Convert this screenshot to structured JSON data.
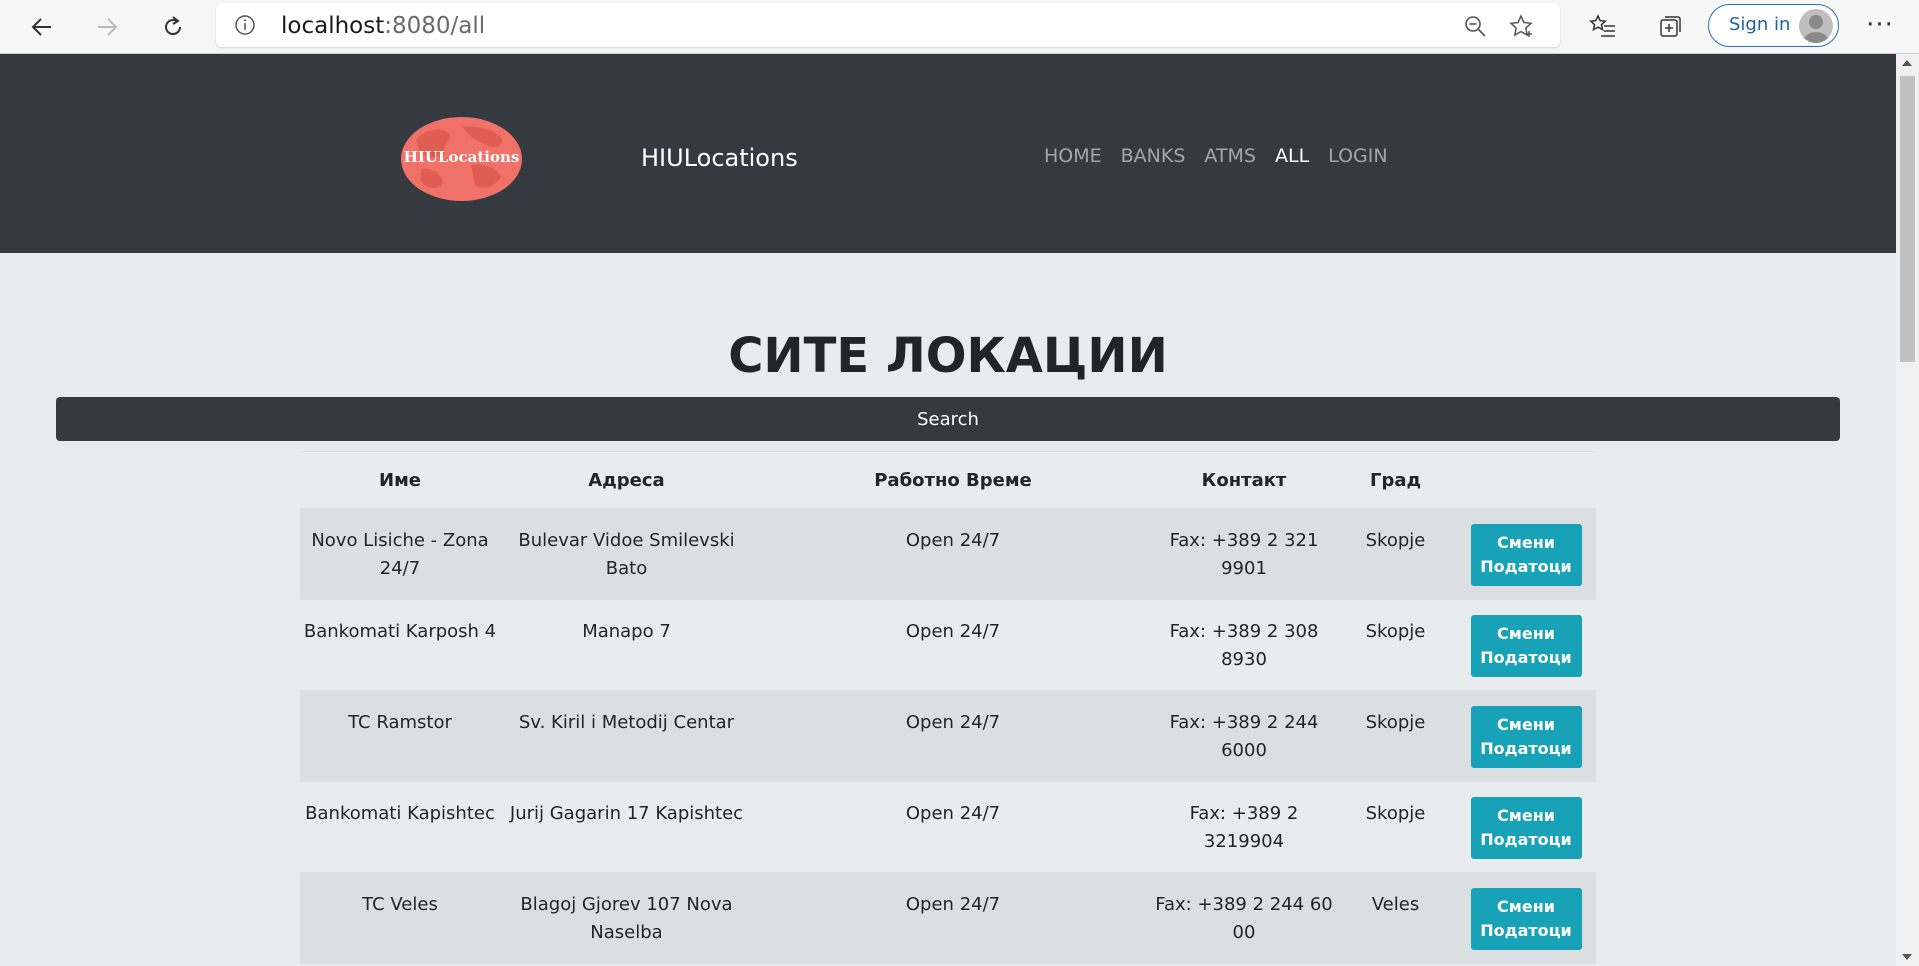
{
  "browser": {
    "url_host": "localhost",
    "url_path": ":8080/all",
    "sign_in_label": "Sign in",
    "more_label": "···"
  },
  "header": {
    "logo_text": "HIULocations",
    "brand": "HIULocations",
    "nav": [
      {
        "label": "HOME",
        "active": false
      },
      {
        "label": "BANKS",
        "active": false
      },
      {
        "label": "ATMS",
        "active": false
      },
      {
        "label": "ALL",
        "active": true
      },
      {
        "label": "LOGIN",
        "active": false
      }
    ]
  },
  "main": {
    "title": "СИТЕ ЛОКАЦИИ",
    "search_label": "Search",
    "columns": [
      "Име",
      "Адреса",
      "Работно Време",
      "Контакт",
      "Град",
      ""
    ],
    "rows": [
      {
        "name": "Novo Lisiche - Zona 24/7",
        "address": "Bulevar Vidoe Smilevski Bato",
        "hours": "Open 24/7",
        "contact": "Fax: +389 2 321 9901",
        "city": "Skopje",
        "action": "Смени Податоци"
      },
      {
        "name": "Bankomati Karposh 4",
        "address": "Manapo 7",
        "hours": "Open 24/7",
        "contact": "Fax: +389 2 308 8930",
        "city": "Skopje",
        "action": "Смени Податоци"
      },
      {
        "name": "TC Ramstor",
        "address": "Sv. Kiril i Metodij Centar",
        "hours": "Open 24/7",
        "contact": "Fax: +389 2 244 6000",
        "city": "Skopje",
        "action": "Смени Податоци"
      },
      {
        "name": "Bankomati Kapishtec",
        "address": "Jurij Gagarin 17 Kapishtec",
        "hours": "Open 24/7",
        "contact": "Fax: +389 2 3219904",
        "city": "Skopje",
        "action": "Смени Податоци"
      },
      {
        "name": "TC Veles",
        "address": "Blagoj Gjorev 107 Nova Naselba",
        "hours": "Open 24/7",
        "contact": "Fax: +389 2 244 60 00",
        "city": "Veles",
        "action": "Смени Податоци"
      }
    ]
  },
  "colors": {
    "header_bg": "#343a40",
    "page_bg": "#e9ecef",
    "button_accent": "#17a2b8",
    "logo_fill": "#f07167"
  }
}
